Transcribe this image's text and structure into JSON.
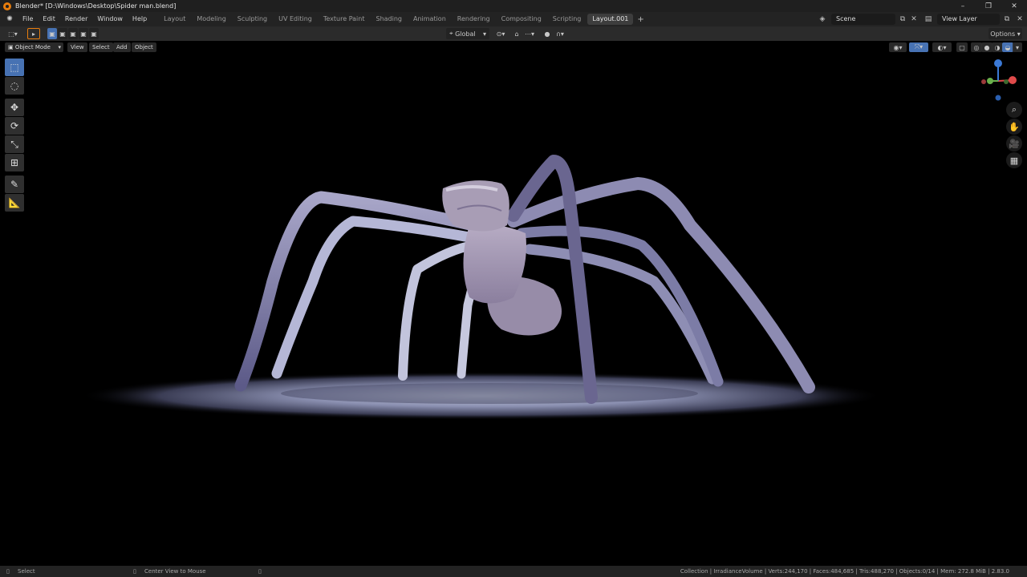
{
  "window": {
    "title": "Blender* [D:\\Windows\\Desktop\\Spider man.blend]",
    "controls": [
      "–",
      "❐",
      "✕"
    ]
  },
  "menu": {
    "items": [
      "File",
      "Edit",
      "Render",
      "Window",
      "Help"
    ]
  },
  "workspaces": {
    "tabs": [
      "Layout",
      "Modeling",
      "Sculpting",
      "UV Editing",
      "Texture Paint",
      "Shading",
      "Animation",
      "Rendering",
      "Compositing",
      "Scripting",
      "Layout.001"
    ],
    "active": "Layout.001",
    "add": "+"
  },
  "scene": {
    "name": "Scene",
    "view_layer": "View Layer"
  },
  "tool_header": {
    "orientation": "Global",
    "options": "Options"
  },
  "viewport_header": {
    "mode": "Object Mode",
    "menus": [
      "View",
      "Select",
      "Add",
      "Object"
    ]
  },
  "status": {
    "left_action": "Select",
    "middle_action": "Center View to Mouse",
    "stats": "Collection | IrradianceVolume | Verts:244,170 | Faces:484,685 | Tris:488,270 | Objects:0/14 | Mem: 272.8 MiB | 2.83.0"
  },
  "colors": {
    "accent": "#4772b3",
    "brand": "#e87d0d",
    "axis_x": "#e04b4b",
    "axis_y": "#6ab04c",
    "axis_z": "#3b79d6"
  }
}
